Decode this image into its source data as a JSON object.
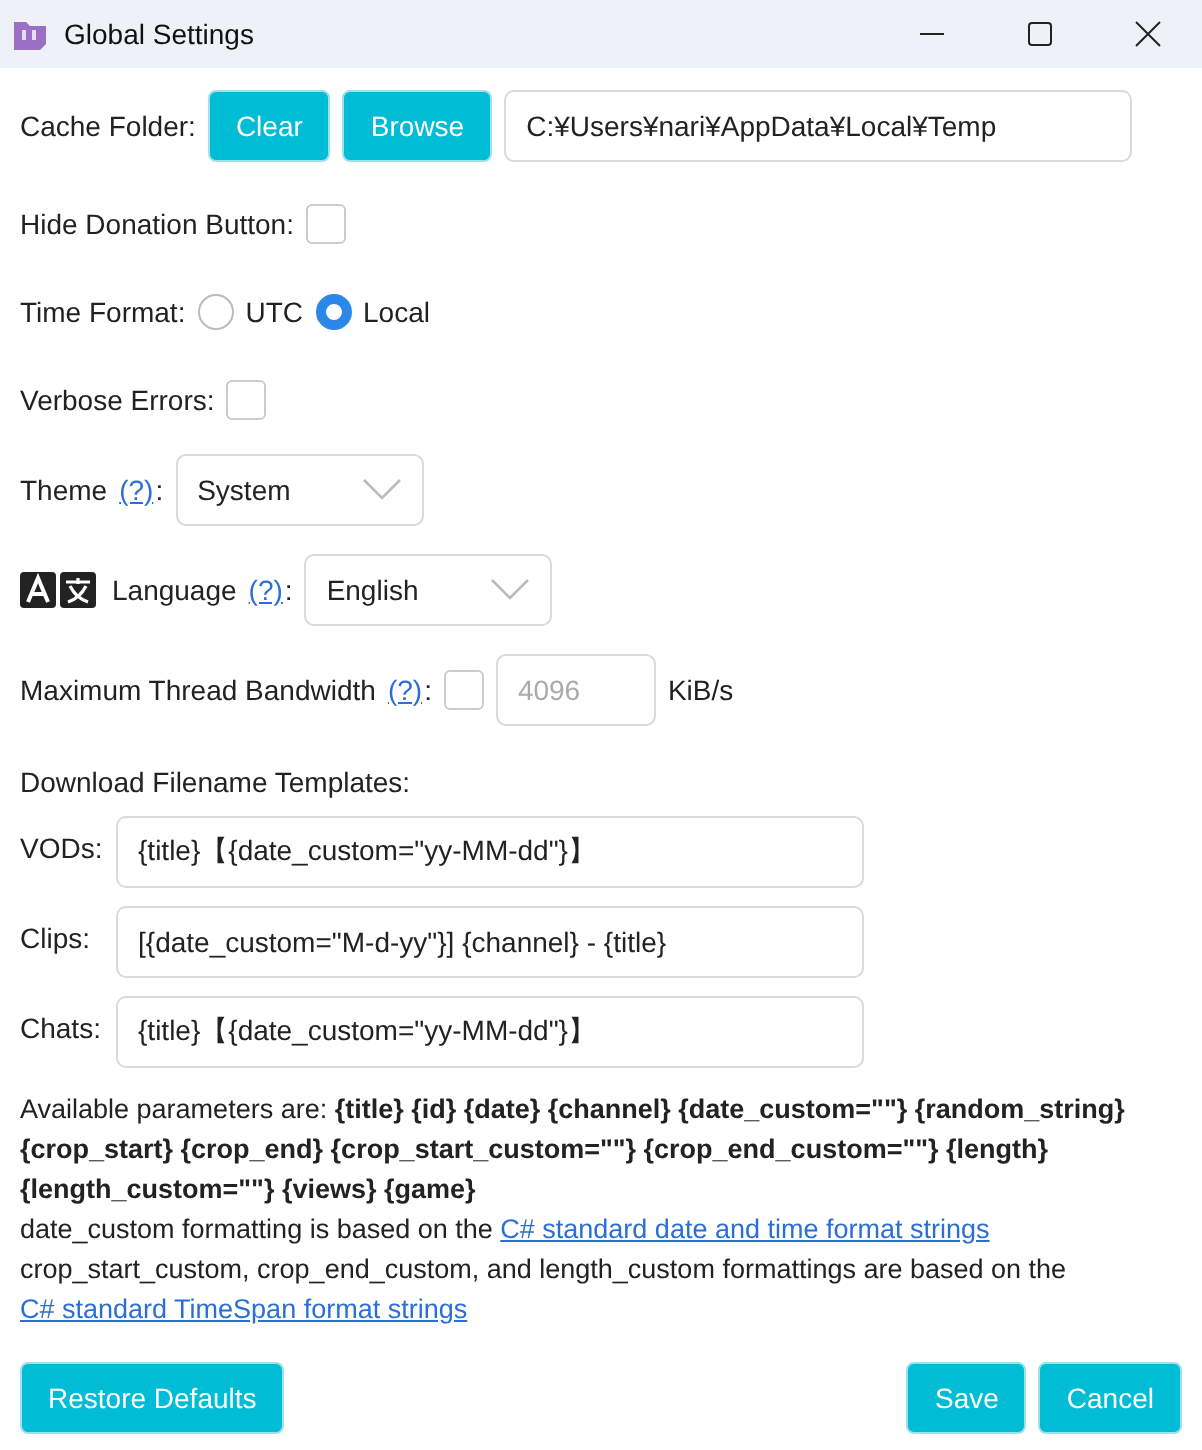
{
  "window": {
    "title": "Global Settings"
  },
  "cache_folder": {
    "label": "Cache Folder:",
    "buttons": [
      "Clear",
      "Browse"
    ],
    "path": "C:¥Users¥nari¥AppData¥Local¥Temp"
  },
  "hide_donation": {
    "label": "Hide Donation Button:",
    "checked": false
  },
  "time_format": {
    "label": "Time Format:",
    "options": [
      {
        "label": "UTC",
        "selected": false
      },
      {
        "label": "Local",
        "selected": true
      }
    ]
  },
  "verbose_errors": {
    "label": "Verbose Errors:",
    "checked": false
  },
  "theme": {
    "label": "Theme",
    "help": "(?)",
    "suffix": ":",
    "value": "System"
  },
  "language": {
    "label": "Language",
    "help": "(?)",
    "suffix": ":",
    "value": "English"
  },
  "bandwidth": {
    "label": "Maximum Thread Bandwidth",
    "help": "(?)",
    "suffix": ":",
    "checked": false,
    "value": "4096",
    "disabled": true,
    "unit": "KiB/s"
  },
  "templates": {
    "heading": "Download Filename Templates:",
    "rows": [
      {
        "label": "VODs:",
        "value": "{title}【{date_custom=\"yy-MM-dd\"}】"
      },
      {
        "label": "Clips:",
        "value": "[{date_custom=\"M-d-yy\"}] {channel} - {title}"
      },
      {
        "label": "Chats:",
        "value": "{title}【{date_custom=\"yy-MM-dd\"}】"
      }
    ]
  },
  "parameters": "Available parameters are: **{title} {id} {date} {channel} {date_custom=\"\"} {random_string} {crop_start} {crop_end} {crop_start_custom=\"\"} {crop_end_custom=\"\"} {length} {length_custom=\"\"} {views} {game}**",
  "notes": [
    {
      "text": "date_custom formatting is based on the ",
      "link": "C# standard date and time format strings"
    },
    {
      "text": "crop_start_custom, crop_end_custom, and length_custom formattings are based on the ",
      "link": "C# standard TimeSpan format strings"
    }
  ],
  "footer": {
    "left": [
      "Restore Defaults"
    ],
    "right": [
      "Save",
      "Cancel"
    ]
  }
}
